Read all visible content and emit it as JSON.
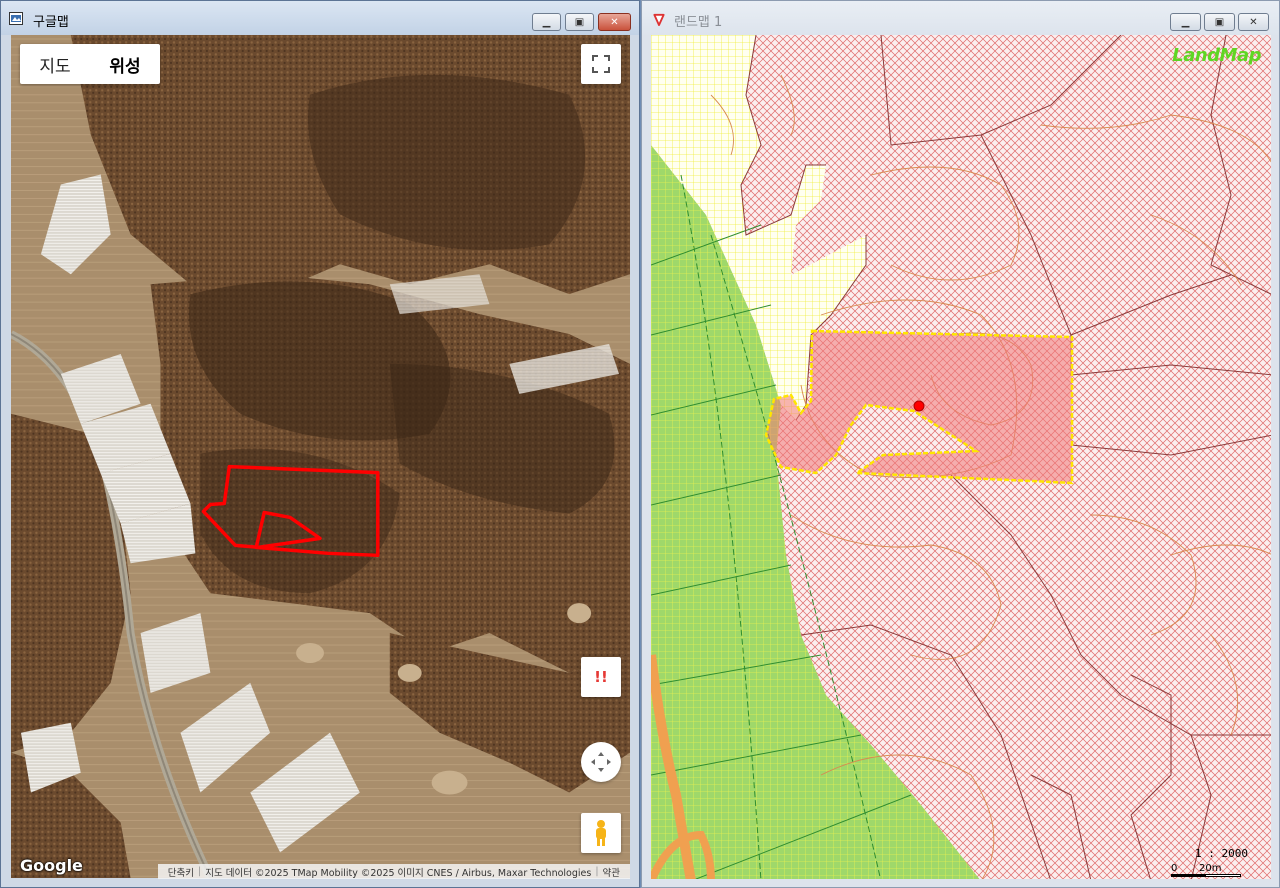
{
  "left_window": {
    "title": "구글맵",
    "map_type": {
      "map_label": "지도",
      "satellite_label": "위성"
    },
    "icons": {
      "fullscreen": "fullscreen-icon",
      "alert": "!!",
      "camera": "camera-move-icon",
      "pegman": "street-view-pegman-icon"
    },
    "google_logo": "Google",
    "attribution": {
      "shortcuts": "단축키",
      "map_data": "지도 데이터 ©2025 TMap Mobility ©2025 이미지 CNES / Airbus, Maxar Technologies",
      "terms": "약관"
    },
    "parcel_outline_color": "#ff0000"
  },
  "right_window": {
    "title": "랜드맵 1",
    "logo": "LandMap",
    "scale": {
      "ratio": "1 : 2000",
      "zero": "0",
      "distance": "20m"
    },
    "colors": {
      "forest_hatch": "#e06060",
      "farmland_hatch": "#ffff00",
      "green_zone": "#9fd86a",
      "selected_fill": "#f28c8c",
      "selected_border": "#ffe600",
      "marker": "#ff0000"
    }
  }
}
